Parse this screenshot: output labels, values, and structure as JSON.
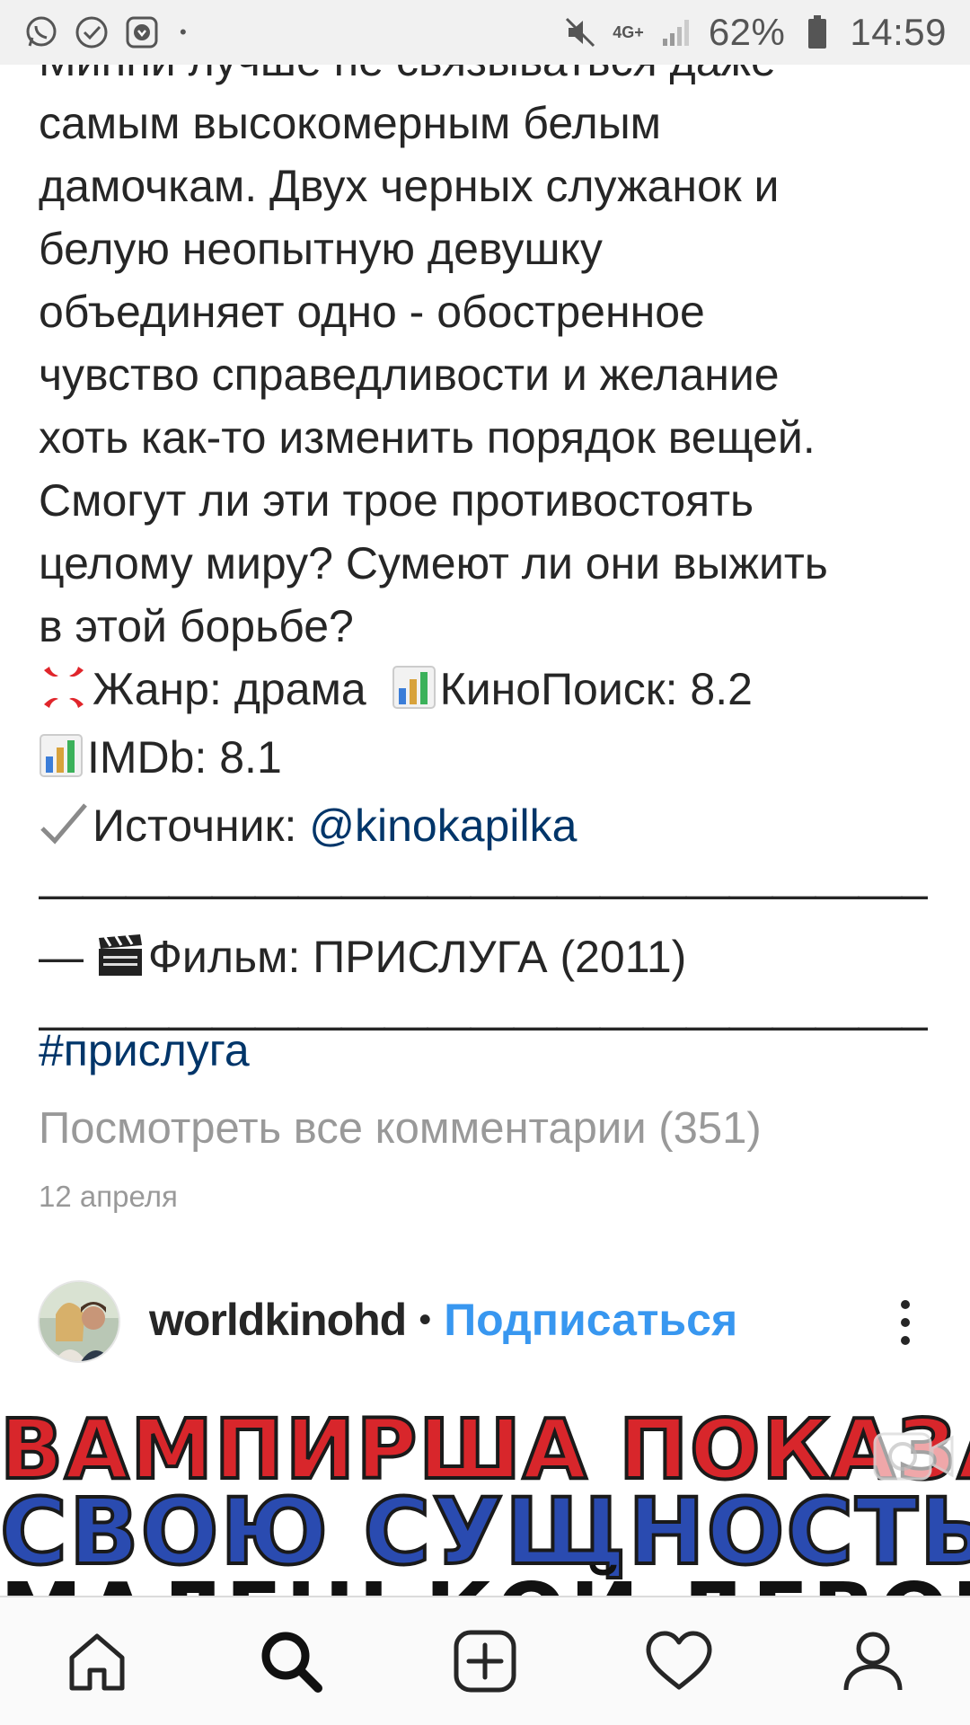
{
  "status_bar": {
    "network": "4G+",
    "battery": "62%",
    "time": "14:59"
  },
  "caption": {
    "partial_top": "Минни лучше не связываться даже",
    "lines": [
      "самым высокомерным белым",
      "дамочкам. Двух черных служанок и",
      "белую неопытную девушку",
      "объединяет одно - обостренное",
      "чувство справедливости и желание",
      "хоть как-то изменить порядок вещей.",
      "Смогут ли эти трое противостоять",
      "целому миру? Сумеют ли они выжить",
      "в этой борьбе?"
    ],
    "genre_text": "Жанр: драма",
    "kinopoisk_text": "КиноПоиск: 8.2",
    "imdb_text": "IMDb: 8.1",
    "source_label": "Источник: ",
    "source_mention": "@kinokapilka",
    "dashes_1": "————————————————————————",
    "film_prefix": "— ",
    "film_text": "Фильм: ПРИСЛУГА (2011)",
    "dashes_2": "——————————————————————"
  },
  "hashtag": "#прислуга",
  "comments_link": "Посмотреть все комментарии (351)",
  "post_date": "12 апреля",
  "next_post": {
    "username": "worldkinohd",
    "separator": "•",
    "follow_label": "Подписаться",
    "media_text": {
      "line1": "ВАМПИРША ПОКАЗАЛА",
      "line2": "СВОЮ СУЩНОСТЬ",
      "line3": "МАЛЕНЬКОЙ ДЕВОЧКЕ"
    }
  },
  "icons": {
    "status_left": [
      "whatsapp-icon",
      "check-circle-icon",
      "download-icon"
    ],
    "status_right": [
      "mute-icon",
      "signal-icon",
      "battery-icon"
    ],
    "nav": [
      "home-icon",
      "search-icon",
      "add-post-icon",
      "heart-icon",
      "profile-icon"
    ]
  },
  "colors": {
    "link_blue": "#003569",
    "follow_blue": "#3897f0",
    "muted_gray": "#999999",
    "text": "#262626"
  }
}
